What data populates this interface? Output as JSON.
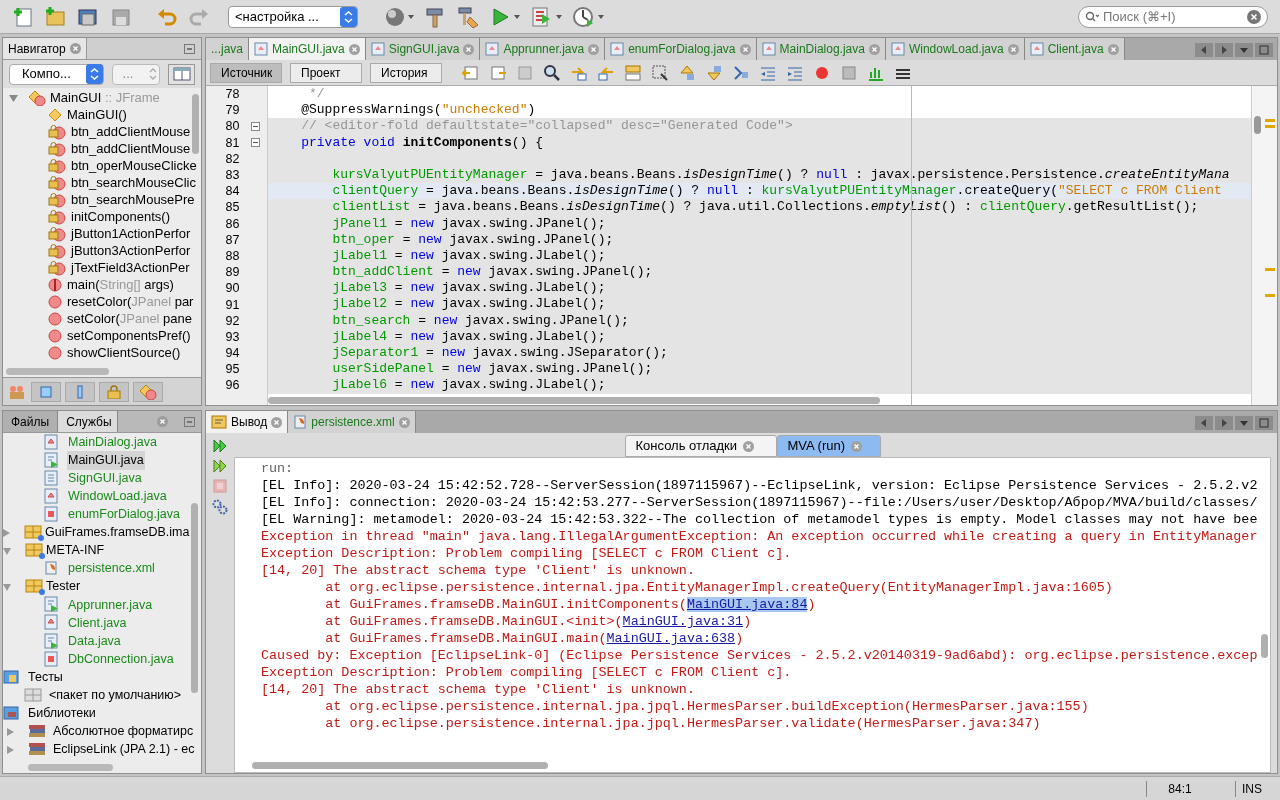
{
  "toolbar": {
    "configuration": "<настройка ...",
    "search_placeholder": "Поиск (⌘+I)"
  },
  "navigator": {
    "title": "Навигатор",
    "view_select": "Компо...",
    "filter_select": "...",
    "items": [
      {
        "kind": "class",
        "expanded": true,
        "parts": [
          {
            "text": "MainGUI",
            "muted": false
          },
          {
            "text": " :: JFrame",
            "muted": true
          }
        ],
        "children": [
          {
            "kind": "constructor",
            "parts": [
              {
                "text": "MainGUI()",
                "muted": false
              }
            ]
          },
          {
            "kind": "private",
            "parts": [
              {
                "text": "btn_addClientMouse",
                "muted": false
              }
            ]
          },
          {
            "kind": "private",
            "parts": [
              {
                "text": "btn_addClientMouse",
                "muted": false
              }
            ]
          },
          {
            "kind": "private",
            "parts": [
              {
                "text": "btn_operMouseClicke",
                "muted": false
              }
            ]
          },
          {
            "kind": "private",
            "parts": [
              {
                "text": "btn_searchMouseClic",
                "muted": false
              }
            ]
          },
          {
            "kind": "private",
            "parts": [
              {
                "text": "btn_searchMousePre",
                "muted": false
              }
            ]
          },
          {
            "kind": "private",
            "parts": [
              {
                "text": "initComponents()",
                "muted": false
              }
            ]
          },
          {
            "kind": "private",
            "parts": [
              {
                "text": "jButton1ActionPerfor",
                "muted": false
              }
            ]
          },
          {
            "kind": "private",
            "parts": [
              {
                "text": "jButton3ActionPerfor",
                "muted": false
              }
            ]
          },
          {
            "kind": "private",
            "parts": [
              {
                "text": "jTextField3ActionPer",
                "muted": false
              }
            ]
          },
          {
            "kind": "static",
            "parts": [
              {
                "text": "main(",
                "muted": false
              },
              {
                "text": "String[]",
                "muted": true
              },
              {
                "text": " args)",
                "muted": false
              }
            ]
          },
          {
            "kind": "method",
            "parts": [
              {
                "text": "resetColor(",
                "muted": false
              },
              {
                "text": "JPanel",
                "muted": true
              },
              {
                "text": " par",
                "muted": false
              }
            ]
          },
          {
            "kind": "method",
            "parts": [
              {
                "text": "setColor(",
                "muted": false
              },
              {
                "text": "JPanel",
                "muted": true
              },
              {
                "text": " pane",
                "muted": false
              }
            ]
          },
          {
            "kind": "method",
            "parts": [
              {
                "text": "setComponentsPref()",
                "muted": false
              }
            ]
          },
          {
            "kind": "method",
            "parts": [
              {
                "text": "showClientSource()",
                "muted": false
              }
            ]
          }
        ]
      }
    ]
  },
  "files_panel": {
    "tabs": [
      {
        "label": "Файлы",
        "selected": false
      },
      {
        "label": "Службы",
        "selected": true
      }
    ],
    "tree": [
      {
        "children": [
          {
            "children": [
              {
                "kind": "form",
                "label": "MainDialog.java",
                "selected": false
              },
              {
                "kind": "main",
                "label": "MainGUI.java",
                "selected": true
              },
              {
                "kind": "plain",
                "label": "SignGUI.java",
                "selected": false
              },
              {
                "kind": "form",
                "label": "WindowLoad.java",
                "selected": false
              },
              {
                "kind": "enum",
                "label": "enumForDialog.java",
                "selected": false
              }
            ]
          },
          {
            "kind": "package",
            "label": "GuiFrames.framseDB.ima",
            "expanded": false
          },
          {
            "kind": "package",
            "label": "META-INF",
            "expanded": true,
            "children": [
              {
                "kind": "xml",
                "label": "persistence.xml",
                "selected": false
              }
            ]
          },
          {
            "kind": "package",
            "label": "Tester",
            "expanded": true,
            "children": [
              {
                "kind": "main",
                "label": "Apprunner.java",
                "selected": false
              },
              {
                "kind": "form",
                "label": "Client.java",
                "selected": false
              },
              {
                "kind": "main",
                "label": "Data.java",
                "selected": false
              },
              {
                "kind": "enum",
                "label": "DbConnection.java",
                "selected": false
              }
            ]
          }
        ]
      },
      {
        "kind": "tests",
        "label": "Тесты",
        "children": [
          {
            "kind": "empty-package",
            "label": "<пакет по умолчанию>"
          }
        ]
      },
      {
        "kind": "libraries",
        "label": "Библиотеки",
        "children": [
          {
            "kind": "library",
            "label": "Абсолютное форматирс",
            "expanded": false
          },
          {
            "kind": "library",
            "label": "EclipseLink (JPA 2.1) - ec",
            "expanded": false
          }
        ]
      }
    ]
  },
  "editor": {
    "tabs": [
      {
        "label": "...java",
        "selected": false,
        "closable": false
      },
      {
        "label": "MainGUI.java",
        "selected": true,
        "closable": true
      },
      {
        "label": "SignGUI.java",
        "selected": false,
        "closable": true
      },
      {
        "label": "Apprunner.java",
        "selected": false,
        "closable": true
      },
      {
        "label": "enumForDialog.java",
        "selected": false,
        "closable": true
      },
      {
        "label": "MainDialog.java",
        "selected": false,
        "closable": true
      },
      {
        "label": "WindowLoad.java",
        "selected": false,
        "closable": true
      },
      {
        "label": "Client.java",
        "selected": false,
        "closable": true
      }
    ],
    "views": [
      {
        "label": "Источник",
        "selected": true
      },
      {
        "label": "Проект",
        "selected": false
      },
      {
        "label": "История",
        "selected": false
      }
    ],
    "lines": [
      {
        "number": "78",
        "guarded": false,
        "current": false,
        "fold": false,
        "tokens": [
          {
            "kind": "comment",
            "text": "     */"
          }
        ]
      },
      {
        "number": "79",
        "guarded": false,
        "current": false,
        "fold": false,
        "tokens": [
          {
            "kind": "plain",
            "text": "    @SuppressWarnings("
          },
          {
            "kind": "string",
            "text": "\"unchecked\""
          },
          {
            "kind": "plain",
            "text": ")"
          }
        ]
      },
      {
        "number": "80",
        "guarded": true,
        "current": false,
        "fold": true,
        "tokens": [
          {
            "kind": "comment",
            "text": "    // <editor-fold defaultstate=\"collapsed\" desc=\"Generated Code\">"
          }
        ]
      },
      {
        "number": "81",
        "guarded": true,
        "current": false,
        "fold": true,
        "tokens": [
          {
            "kind": "keyword",
            "text": "    private void "
          },
          {
            "kind": "bold",
            "text": "initComponents"
          },
          {
            "kind": "plain",
            "text": "() {"
          }
        ]
      },
      {
        "number": "82",
        "guarded": true,
        "current": false,
        "fold": false
      },
      {
        "number": "83",
        "guarded": true,
        "current": false,
        "fold": false,
        "tokens": [
          {
            "kind": "field",
            "text": "        kursValyutPUEntityManager"
          },
          {
            "kind": "plain",
            "text": " = java.beans.Beans."
          },
          {
            "kind": "italic",
            "text": "isDesignTime"
          },
          {
            "kind": "plain",
            "text": "() ? "
          },
          {
            "kind": "keyword",
            "text": "null"
          },
          {
            "kind": "plain",
            "text": " : javax.persistence.Persistence."
          },
          {
            "kind": "italic",
            "text": "createEntityMana"
          }
        ]
      },
      {
        "number": "84",
        "guarded": true,
        "current": true,
        "fold": false,
        "tokens": [
          {
            "kind": "field",
            "text": "        clientQuery"
          },
          {
            "kind": "plain",
            "text": " = java.beans.Beans."
          },
          {
            "kind": "italic",
            "text": "isDesignTime"
          },
          {
            "kind": "plain",
            "text": "() ? "
          },
          {
            "kind": "keyword",
            "text": "null"
          },
          {
            "kind": "plain",
            "text": " : "
          },
          {
            "kind": "field",
            "text": "kursValyutPUEntityManager"
          },
          {
            "kind": "plain",
            "text": ".createQuery("
          },
          {
            "kind": "string",
            "text": "\"SELECT c FROM Client"
          }
        ]
      },
      {
        "number": "85",
        "guarded": true,
        "current": false,
        "fold": false,
        "tokens": [
          {
            "kind": "field",
            "text": "        clientList"
          },
          {
            "kind": "plain",
            "text": " = java.beans.Beans."
          },
          {
            "kind": "italic",
            "text": "isDesignTime"
          },
          {
            "kind": "plain",
            "text": "() ? java.util.Collections."
          },
          {
            "kind": "italic",
            "text": "emptyList"
          },
          {
            "kind": "plain",
            "text": "() : "
          },
          {
            "kind": "field",
            "text": "clientQuery"
          },
          {
            "kind": "plain",
            "text": ".getResultList();"
          }
        ]
      },
      {
        "number": "86",
        "guarded": true,
        "current": false,
        "fold": false,
        "tokens": [
          {
            "kind": "field",
            "text": "        jPanel1"
          },
          {
            "kind": "plain",
            "text": " = "
          },
          {
            "kind": "keyword",
            "text": "new"
          },
          {
            "kind": "plain",
            "text": " javax.swing.JPanel();"
          }
        ]
      },
      {
        "number": "87",
        "guarded": true,
        "current": false,
        "fold": false,
        "tokens": [
          {
            "kind": "field",
            "text": "        btn_oper"
          },
          {
            "kind": "plain",
            "text": " = "
          },
          {
            "kind": "keyword",
            "text": "new"
          },
          {
            "kind": "plain",
            "text": " javax.swing.JPanel();"
          }
        ]
      },
      {
        "number": "88",
        "guarded": true,
        "current": false,
        "fold": false,
        "tokens": [
          {
            "kind": "field",
            "text": "        jLabel1"
          },
          {
            "kind": "plain",
            "text": " = "
          },
          {
            "kind": "keyword",
            "text": "new"
          },
          {
            "kind": "plain",
            "text": " javax.swing.JLabel();"
          }
        ]
      },
      {
        "number": "89",
        "guarded": true,
        "current": false,
        "fold": false,
        "tokens": [
          {
            "kind": "field",
            "text": "        btn_addClient"
          },
          {
            "kind": "plain",
            "text": " = "
          },
          {
            "kind": "keyword",
            "text": "new"
          },
          {
            "kind": "plain",
            "text": " javax.swing.JPanel();"
          }
        ]
      },
      {
        "number": "90",
        "guarded": true,
        "current": false,
        "fold": false,
        "tokens": [
          {
            "kind": "field",
            "text": "        jLabel3"
          },
          {
            "kind": "plain",
            "text": " = "
          },
          {
            "kind": "keyword",
            "text": "new"
          },
          {
            "kind": "plain",
            "text": " javax.swing.JLabel();"
          }
        ]
      },
      {
        "number": "91",
        "guarded": true,
        "current": false,
        "fold": false,
        "tokens": [
          {
            "kind": "field",
            "text": "        jLabel2"
          },
          {
            "kind": "plain",
            "text": " = "
          },
          {
            "kind": "keyword",
            "text": "new"
          },
          {
            "kind": "plain",
            "text": " javax.swing.JLabel();"
          }
        ]
      },
      {
        "number": "92",
        "guarded": true,
        "current": false,
        "fold": false,
        "tokens": [
          {
            "kind": "field",
            "text": "        btn_search"
          },
          {
            "kind": "plain",
            "text": " = "
          },
          {
            "kind": "keyword",
            "text": "new"
          },
          {
            "kind": "plain",
            "text": " javax.swing.JPanel();"
          }
        ]
      },
      {
        "number": "93",
        "guarded": true,
        "current": false,
        "fold": false,
        "tokens": [
          {
            "kind": "field",
            "text": "        jLabel4"
          },
          {
            "kind": "plain",
            "text": " = "
          },
          {
            "kind": "keyword",
            "text": "new"
          },
          {
            "kind": "plain",
            "text": " javax.swing.JLabel();"
          }
        ]
      },
      {
        "number": "94",
        "guarded": true,
        "current": false,
        "fold": false,
        "tokens": [
          {
            "kind": "field",
            "text": "        jSeparator1"
          },
          {
            "kind": "plain",
            "text": " = "
          },
          {
            "kind": "keyword",
            "text": "new"
          },
          {
            "kind": "plain",
            "text": " javax.swing.JSeparator();"
          }
        ]
      },
      {
        "number": "95",
        "guarded": true,
        "current": false,
        "fold": false,
        "tokens": [
          {
            "kind": "field",
            "text": "        userSidePanel"
          },
          {
            "kind": "plain",
            "text": " = "
          },
          {
            "kind": "keyword",
            "text": "new"
          },
          {
            "kind": "plain",
            "text": " javax.swing.JPanel();"
          }
        ]
      },
      {
        "number": "96",
        "guarded": true,
        "current": false,
        "fold": false,
        "tokens": [
          {
            "kind": "field",
            "text": "        jLabel6"
          },
          {
            "kind": "plain",
            "text": " = "
          },
          {
            "kind": "keyword",
            "text": "new"
          },
          {
            "kind": "plain",
            "text": " javax.swing.JLabel();"
          }
        ]
      }
    ]
  },
  "output": {
    "tabs": [
      {
        "label": "Вывод",
        "selected": true,
        "kind": "output"
      },
      {
        "label": "persistence.xml",
        "selected": false,
        "kind": "xml"
      }
    ],
    "consoles": [
      {
        "label": "Консоль отладки",
        "selected": false
      },
      {
        "label": "MVA (run)",
        "selected": true
      }
    ],
    "lines": [
      {
        "kind": "muted",
        "text": "run:"
      },
      {
        "kind": "info",
        "text": "[EL Info]: 2020-03-24 15:42:52.728--ServerSession(1897115967)--EclipseLink, version: Eclipse Persistence Services - 2.5.2.v2"
      },
      {
        "kind": "info",
        "text": "[EL Info]: connection: 2020-03-24 15:42:53.277--ServerSession(1897115967)--file:/Users/user/Desktop/Аброр/MVA/build/classes/"
      },
      {
        "kind": "info",
        "text": "[EL Warning]: metamodel: 2020-03-24 15:42:53.322--The collection of metamodel types is empty. Model classes may not have bee"
      },
      {
        "kind": "error",
        "text": "Exception in thread \"main\" java.lang.IllegalArgumentException: An exception occurred while creating a query in EntityManager"
      },
      {
        "kind": "error",
        "text": "Exception Description: Problem compiling [SELECT c FROM Client c]."
      },
      {
        "kind": "error",
        "text": "[14, 20] The abstract schema type 'Client' is unknown."
      },
      {
        "kind": "error",
        "text": "        at org.eclipse.persistence.internal.jpa.EntityManagerImpl.createQuery(EntityManagerImpl.java:1605)"
      },
      {
        "kind": "error",
        "text": "        at GuiFrames.framseDB.MainGUI.initComponents(",
        "link": {
          "text": "MainGUI.java:84",
          "selected": true
        },
        "after": ")"
      },
      {
        "kind": "error",
        "text": "        at GuiFrames.framseDB.MainGUI.<init>(",
        "link": {
          "text": "MainGUI.java:31",
          "selected": false
        },
        "after": ")"
      },
      {
        "kind": "error",
        "text": "        at GuiFrames.framseDB.MainGUI.main(",
        "link": {
          "text": "MainGUI.java:638",
          "selected": false
        },
        "after": ")"
      },
      {
        "kind": "error",
        "text": "Caused by: Exception [EclipseLink-0] (Eclipse Persistence Services - 2.5.2.v20140319-9ad6abd): org.eclipse.persistence.excep"
      },
      {
        "kind": "error",
        "text": "Exception Description: Problem compiling [SELECT c FROM Client c]."
      },
      {
        "kind": "error",
        "text": "[14, 20] The abstract schema type 'Client' is unknown."
      },
      {
        "kind": "error",
        "text": "        at org.eclipse.persistence.internal.jpa.jpql.HermesParser.buildException(HermesParser.java:155)"
      },
      {
        "kind": "error",
        "text": "        at org.eclipse.persistence.internal.jpa.jpql.HermesParser.validate(HermesParser.java:347)"
      }
    ]
  },
  "status_bar": {
    "position": "84:1",
    "mode": "INS"
  }
}
